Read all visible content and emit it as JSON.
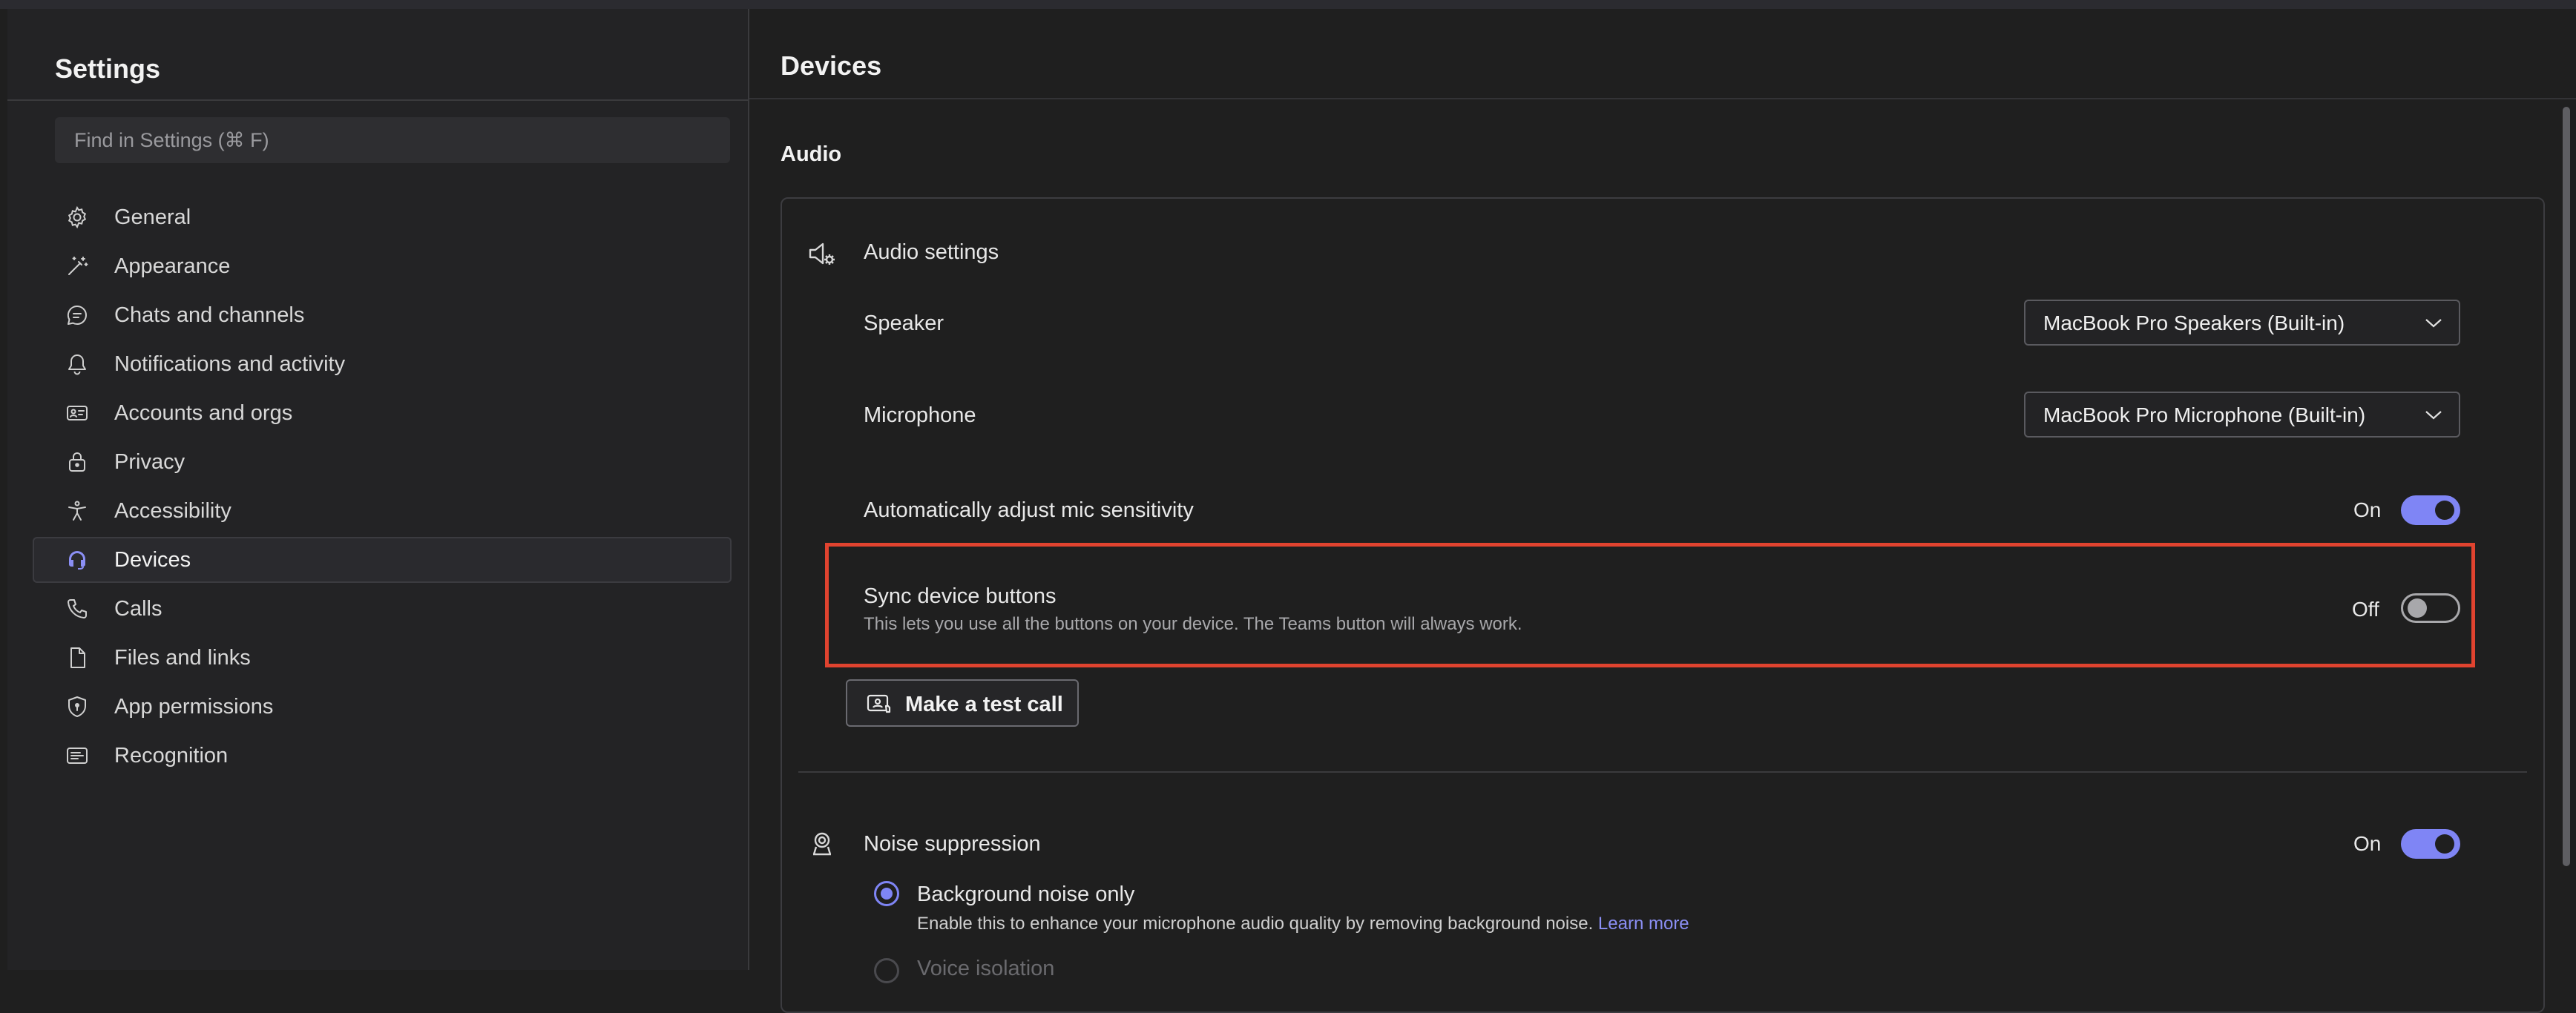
{
  "sidebar": {
    "title": "Settings",
    "search_placeholder": "Find in Settings (⌘ F)",
    "items": [
      {
        "label": "General",
        "icon": "gear-icon"
      },
      {
        "label": "Appearance",
        "icon": "magic-wand-icon"
      },
      {
        "label": "Chats and channels",
        "icon": "chat-bubble-icon"
      },
      {
        "label": "Notifications and activity",
        "icon": "bell-icon"
      },
      {
        "label": "Accounts and orgs",
        "icon": "id-card-icon"
      },
      {
        "label": "Privacy",
        "icon": "lock-icon"
      },
      {
        "label": "Accessibility",
        "icon": "accessibility-icon"
      },
      {
        "label": "Devices",
        "icon": "headset-icon",
        "active": true
      },
      {
        "label": "Calls",
        "icon": "phone-icon"
      },
      {
        "label": "Files and links",
        "icon": "document-icon"
      },
      {
        "label": "App permissions",
        "icon": "shield-icon"
      },
      {
        "label": "Recognition",
        "icon": "recognition-icon"
      }
    ]
  },
  "main": {
    "title": "Devices",
    "section": "Audio",
    "audio_settings": {
      "heading": "Audio settings",
      "speaker_label": "Speaker",
      "speaker_value": "MacBook Pro Speakers (Built-in)",
      "microphone_label": "Microphone",
      "microphone_value": "MacBook Pro Microphone (Built-in)",
      "auto_adjust_label": "Automatically adjust mic sensitivity",
      "auto_adjust_state": "On",
      "sync_label": "Sync device buttons",
      "sync_description": "This lets you use all the buttons on your device. The Teams button will always work.",
      "sync_state": "Off",
      "test_call_label": "Make a test call"
    },
    "noise_suppression": {
      "heading": "Noise suppression",
      "state": "On",
      "option_background_label": "Background noise only",
      "option_background_description": "Enable this to enhance your microphone audio quality by removing background noise.",
      "learn_more": "Learn more",
      "option_voice_label": "Voice isolation"
    }
  },
  "colors": {
    "accent": "#7f85f5",
    "highlight": "#e0432f"
  }
}
